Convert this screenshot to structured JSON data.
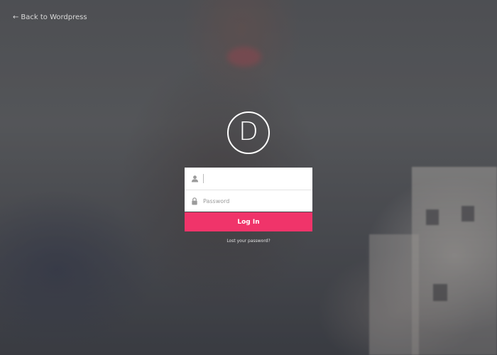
{
  "back_link": {
    "arrow": "←",
    "label": "Back to Wordpress"
  },
  "logo": {
    "letter": "D"
  },
  "login_form": {
    "username": {
      "value": "",
      "placeholder": "",
      "icon": "user-icon"
    },
    "password": {
      "value": "",
      "placeholder": "Password",
      "icon": "lock-icon"
    },
    "submit_label": "Log In",
    "lost_password_label": "Lost your password?"
  },
  "colors": {
    "accent": "#f0346a",
    "field_bg": "#ffffff",
    "text_light": "#d9d9d9"
  }
}
